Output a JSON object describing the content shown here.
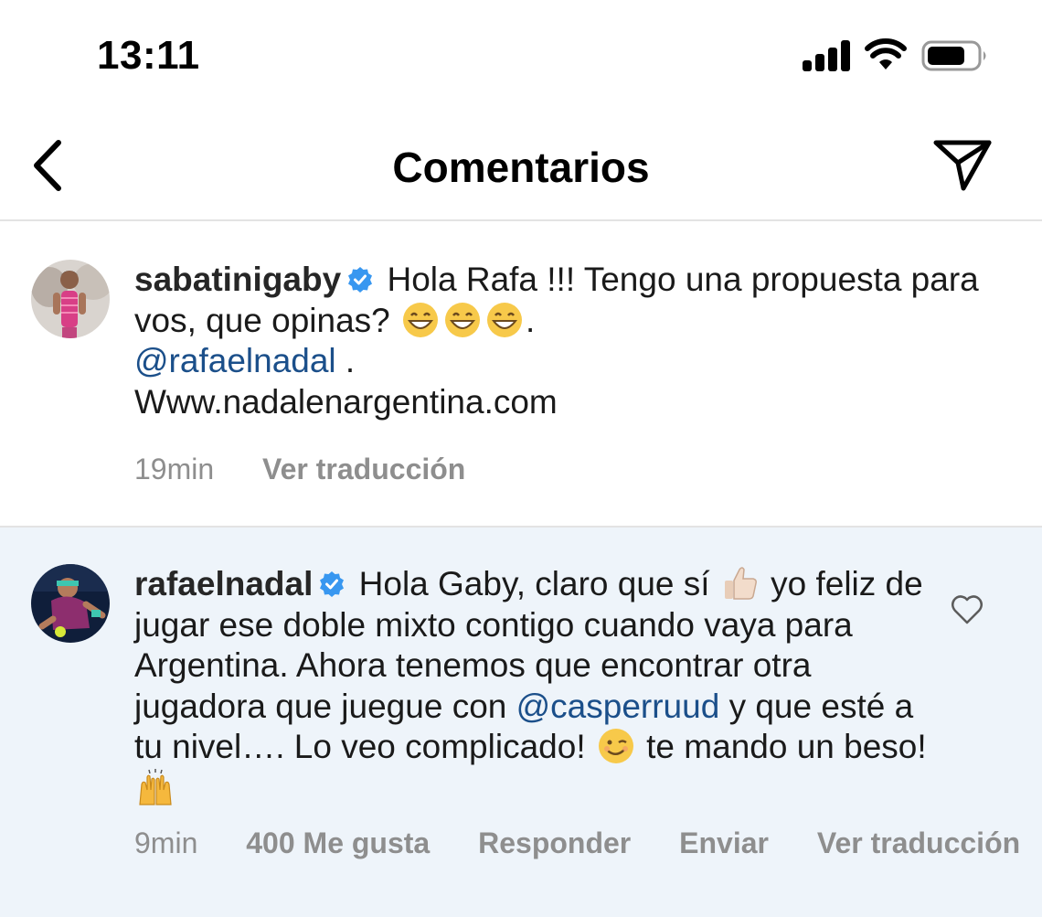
{
  "status_bar": {
    "time": "13:11"
  },
  "header": {
    "title": "Comentarios"
  },
  "comments": [
    {
      "username": "sabatinigaby",
      "verified": true,
      "text_part1": "Hola Rafa !!! Tengo una propuesta para vos, que opinas?",
      "text_part2": ".",
      "mention": "@rafaelnadal",
      "text_part3": " .",
      "url": "Www.nadalenargentina.com",
      "emojis": [
        "grinning-face",
        "grinning-face",
        "grinning-face"
      ],
      "time": "19min",
      "translate_label": "Ver traducción"
    },
    {
      "username": "rafaelnadal",
      "verified": true,
      "text_part1": "Hola Gaby, claro que sí",
      "text_part2": " yo feliz de jugar ese doble mixto contigo cuando vaya para Argentina. Ahora tenemos que encontrar otra jugadora que juegue con ",
      "mention": "@casperruud",
      "text_part3": " y que esté a tu nivel…. Lo veo complicado!",
      "text_part4": " te mando un beso!",
      "emojis": [
        "thumbs-up",
        "winking-face",
        "raising-hands"
      ],
      "time": "9min",
      "likes_label": "400 Me gusta",
      "reply_label": "Responder",
      "send_label": "Enviar",
      "translate_label": "Ver traducción"
    }
  ],
  "colors": {
    "mention": "#1b4f8a",
    "verified": "#3897f0",
    "meta": "#8e8e8e",
    "highlight_bg": "#eef4fa"
  }
}
